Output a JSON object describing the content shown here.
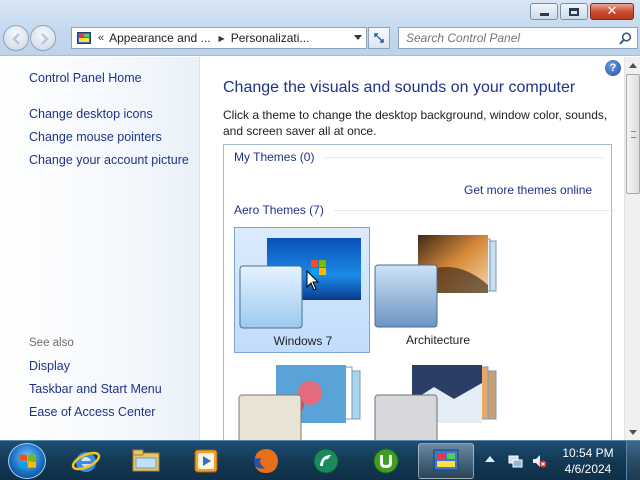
{
  "window": {
    "address": {
      "separator": "«",
      "crumbs": [
        "Appearance and ...",
        "Personalizati..."
      ]
    },
    "search": {
      "placeholder": "Search Control Panel"
    }
  },
  "sidebar": {
    "home": "Control Panel Home",
    "items": [
      {
        "label": "Change desktop icons"
      },
      {
        "label": "Change mouse pointers"
      },
      {
        "label": "Change your account picture"
      }
    ],
    "see_also_heading": "See also",
    "see_also": [
      {
        "label": "Display"
      },
      {
        "label": "Taskbar and Start Menu"
      },
      {
        "label": "Ease of Access Center"
      }
    ]
  },
  "main": {
    "help_glyph": "?",
    "title": "Change the visuals and sounds on your computer",
    "description": "Click a theme to change the desktop background, window color, sounds, and screen saver all at once.",
    "my_themes": "My Themes (0)",
    "get_more": "Get more themes online",
    "aero_themes": "Aero Themes (7)",
    "themes": [
      {
        "name": "Windows 7",
        "selected": true
      },
      {
        "name": "Architecture",
        "selected": false
      },
      {
        "name": "",
        "selected": false
      },
      {
        "name": "",
        "selected": false
      }
    ]
  },
  "taskbar": {
    "apps": [
      "internet-explorer",
      "windows-explorer",
      "media-player",
      "firefox",
      "app-green-circle",
      "utorrent",
      "control-panel"
    ],
    "active_app": "control-panel",
    "clock": {
      "time": "10:54 PM",
      "date": "4/6/2024"
    }
  },
  "colors": {
    "link": "#1e3287",
    "selection": "#c1dcfc",
    "taskbar": "#133955"
  }
}
